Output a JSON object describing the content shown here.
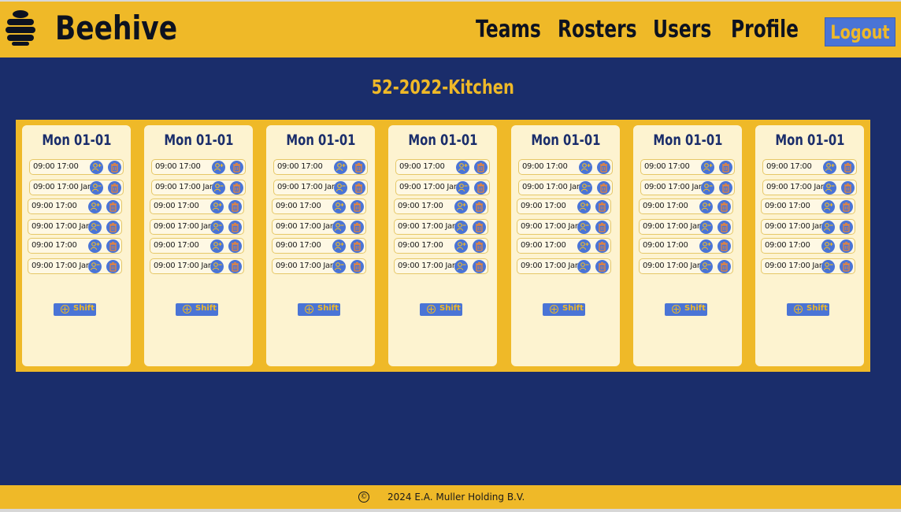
{
  "app": {
    "brand": "Beehive",
    "logo_icon": "beehive-icon"
  },
  "nav": {
    "teams": "Teams",
    "rosters": "Rosters",
    "users": "Users",
    "profile": "Profile",
    "logout": "Logout"
  },
  "page": {
    "title": "52-2022-Kitchen"
  },
  "columns": [
    {
      "day": "Mon 01-01",
      "add_label": "Shift",
      "shifts": [
        "09:00 17:00",
        "09:00 17:00 Jan",
        "09:00 17:00",
        "09:00 17:00 Jan",
        "09:00 17:00",
        "09:00 17:00 Jan"
      ]
    },
    {
      "day": "Mon 01-01",
      "add_label": "Shift",
      "shifts": [
        "09:00 17:00",
        "09:00 17:00 Jan",
        "09:00 17:00",
        "09:00 17:00 Jan",
        "09:00 17:00",
        "09:00 17:00 Jan"
      ]
    },
    {
      "day": "Mon 01-01",
      "add_label": "Shift",
      "shifts": [
        "09:00 17:00",
        "09:00 17:00 Jan",
        "09:00 17:00",
        "09:00 17:00 Jan",
        "09:00 17:00",
        "09:00 17:00 Jan"
      ]
    },
    {
      "day": "Mon 01-01",
      "add_label": "Shift",
      "shifts": [
        "09:00 17:00",
        "09:00 17:00 Jan",
        "09:00 17:00",
        "09:00 17:00 Jan",
        "09:00 17:00",
        "09:00 17:00 Jan"
      ]
    },
    {
      "day": "Mon 01-01",
      "add_label": "Shift",
      "shifts": [
        "09:00 17:00",
        "09:00 17:00 Jan",
        "09:00 17:00",
        "09:00 17:00 Jan",
        "09:00 17:00",
        "09:00 17:00 Jan"
      ]
    },
    {
      "day": "Mon 01-01",
      "add_label": "Shift",
      "shifts": [
        "09:00 17:00",
        "09:00 17:00 Jan",
        "09:00 17:00",
        "09:00 17:00 Jan",
        "09:00 17:00",
        "09:00 17:00 Jan"
      ]
    },
    {
      "day": "Mon 01-01",
      "add_label": "Shift",
      "shifts": [
        "09:00 17:00",
        "09:00 17:00 Jan",
        "09:00 17:00",
        "09:00 17:00 Jan",
        "09:00 17:00",
        "09:00 17:00 Jan"
      ]
    }
  ],
  "icons": {
    "assign": "assign-user-icon",
    "unassign": "unassign-user-icon",
    "delete": "trash-icon",
    "add": "plus-circle-icon",
    "copyright": "copyright-icon"
  },
  "footer": {
    "copyright_symbol": "©",
    "text": "2024  E.A. Muller Holding B.V."
  },
  "colors": {
    "background": "#1a2d6b",
    "accent": "#efb928",
    "button": "#4a74d6",
    "card": "#fdf3d0",
    "trash": "#e8843a"
  }
}
